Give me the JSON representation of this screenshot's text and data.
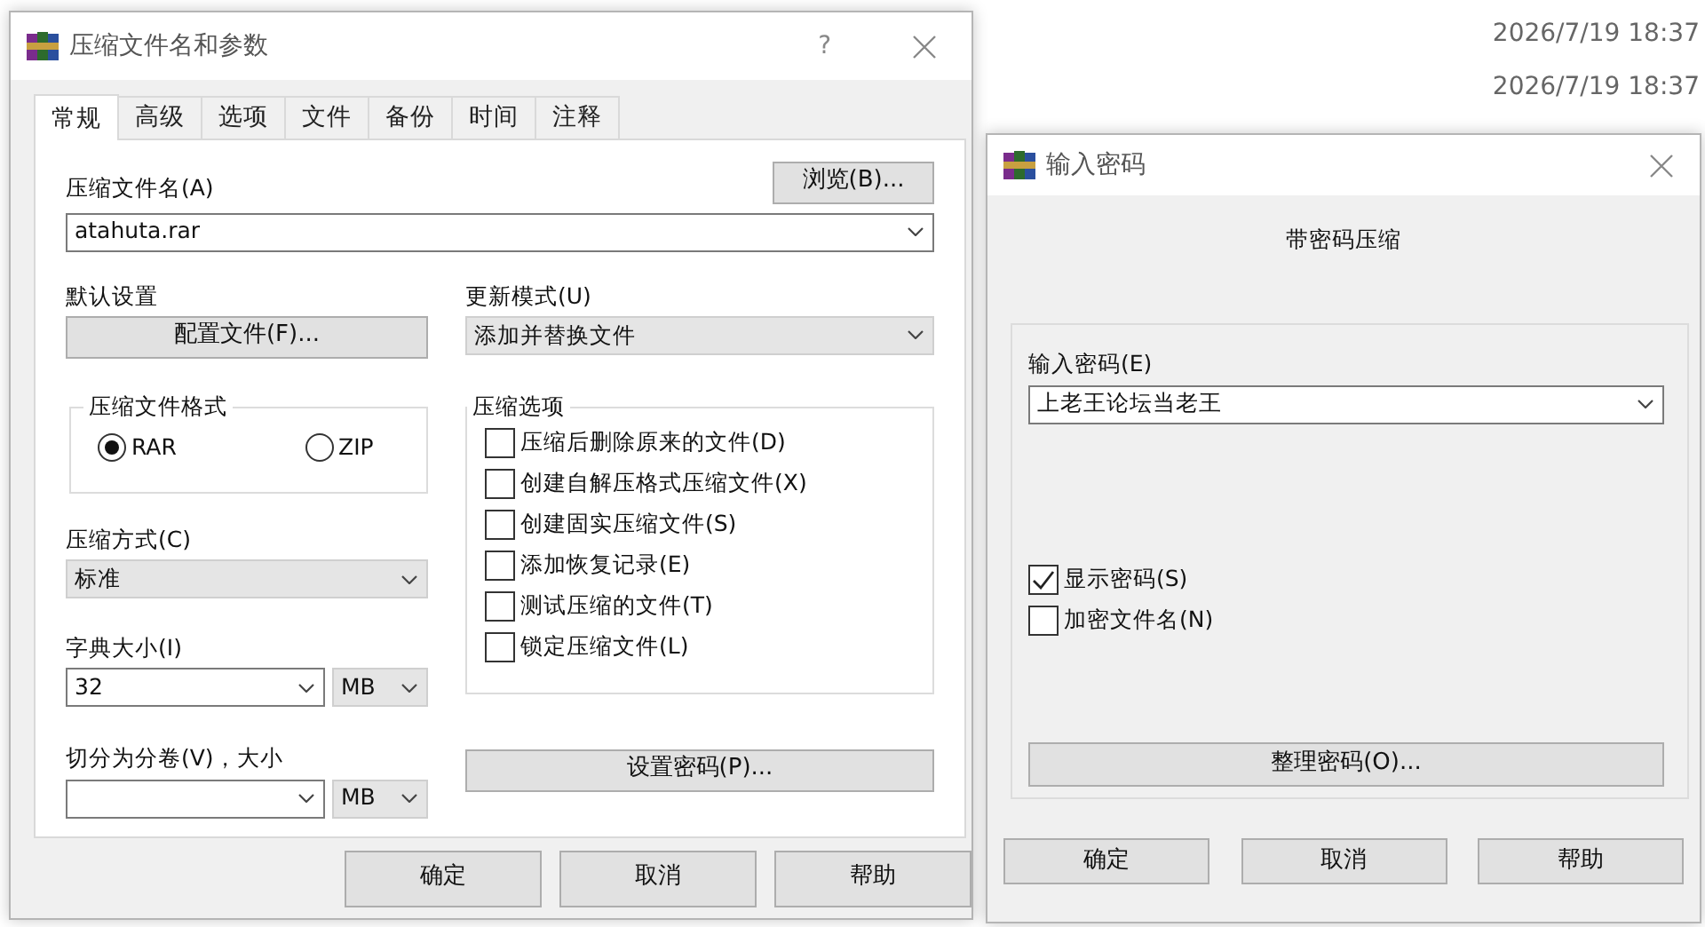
{
  "background_list": {
    "dates": [
      "2026/7/19 18:37",
      "2026/7/19 18:37"
    ]
  },
  "archive_dialog": {
    "title": "压缩文件名和参数",
    "help_button": "?",
    "tabs": [
      {
        "label": "常规",
        "selected": true
      },
      {
        "label": "高级",
        "selected": false
      },
      {
        "label": "选项",
        "selected": false
      },
      {
        "label": "文件",
        "selected": false
      },
      {
        "label": "备份",
        "selected": false
      },
      {
        "label": "时间",
        "selected": false
      },
      {
        "label": "注释",
        "selected": false
      }
    ],
    "archive_name": {
      "label": "压缩文件名(A)",
      "value": "atahuta.rar",
      "kind": "editable"
    },
    "browse_button": "浏览(B)...",
    "default_settings": {
      "label": "默认设置",
      "button": "配置文件(F)..."
    },
    "update_mode": {
      "label": "更新模式(U)",
      "value": "添加并替换文件",
      "kind": "list"
    },
    "archive_format": {
      "title": "压缩文件格式",
      "options": [
        {
          "label": "RAR",
          "selected": true
        },
        {
          "label": "ZIP",
          "selected": false
        }
      ]
    },
    "compression_method": {
      "label": "压缩方式(C)",
      "value": "标准",
      "kind": "list"
    },
    "dictionary_size": {
      "label": "字典大小(I)",
      "value": "32",
      "kind": "editable",
      "unit": {
        "value": "MB",
        "kind": "list"
      }
    },
    "split_volumes": {
      "label": "切分为分卷(V)，大小",
      "kind": "editable",
      "unit": {
        "value": "MB",
        "kind": "list"
      }
    },
    "options": {
      "title": "压缩选项",
      "items": [
        {
          "label": "压缩后删除原来的文件(D)",
          "checked": false
        },
        {
          "label": "创建自解压格式压缩文件(X)",
          "checked": false
        },
        {
          "label": "创建固实压缩文件(S)",
          "checked": false
        },
        {
          "label": "添加恢复记录(E)",
          "checked": false
        },
        {
          "label": "测试压缩的文件(T)",
          "checked": false
        },
        {
          "label": "锁定压缩文件(L)",
          "checked": false
        }
      ]
    },
    "set_password_button": "设置密码(P)...",
    "buttons": [
      "确定",
      "取消",
      "帮助"
    ]
  },
  "password_dialog": {
    "title": "输入密码",
    "subtitle": "带密码压缩",
    "password": {
      "label": "输入密码(E)",
      "value": "上老王论坛当老王",
      "kind": "editable"
    },
    "checkboxes": [
      {
        "label": "显示密码(S)",
        "checked": true
      },
      {
        "label": "加密文件名(N)",
        "checked": false
      }
    ],
    "organize_button": "整理密码(O)...",
    "buttons": [
      "确定",
      "取消",
      "帮助"
    ]
  }
}
